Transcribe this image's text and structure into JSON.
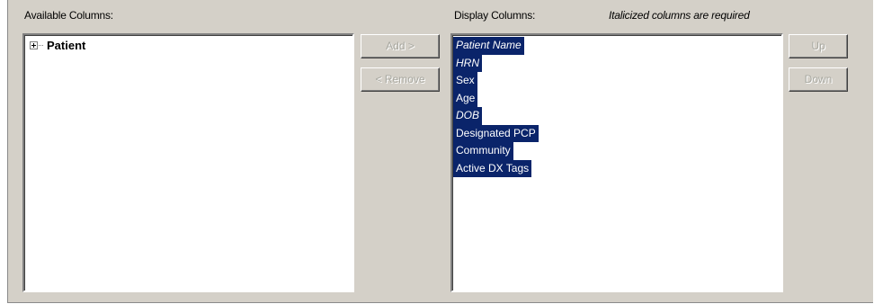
{
  "labels": {
    "available_columns": "Available Columns:",
    "display_columns": "Display Columns:",
    "required_note": "Italicized columns are required"
  },
  "available_tree": {
    "root_label": "Patient",
    "expander": "plus-expander-icon"
  },
  "buttons": {
    "add": "Add >",
    "remove": "< Remove",
    "up": "Up",
    "down": "Down"
  },
  "display_columns": [
    {
      "label": "Patient Name",
      "required": true,
      "selected": true
    },
    {
      "label": "HRN",
      "required": true,
      "selected": true
    },
    {
      "label": "Sex",
      "required": false,
      "selected": true
    },
    {
      "label": "Age",
      "required": false,
      "selected": true
    },
    {
      "label": "DOB",
      "required": true,
      "selected": true
    },
    {
      "label": "Designated PCP",
      "required": false,
      "selected": true
    },
    {
      "label": "Community",
      "required": false,
      "selected": true
    },
    {
      "label": "Active DX Tags",
      "required": false,
      "selected": true
    }
  ],
  "colors": {
    "dialog_bg": "#d4d0c8",
    "selection_bg": "#0a246a",
    "selection_text": "#ffffff",
    "disabled_text": "#a8a8a0"
  }
}
